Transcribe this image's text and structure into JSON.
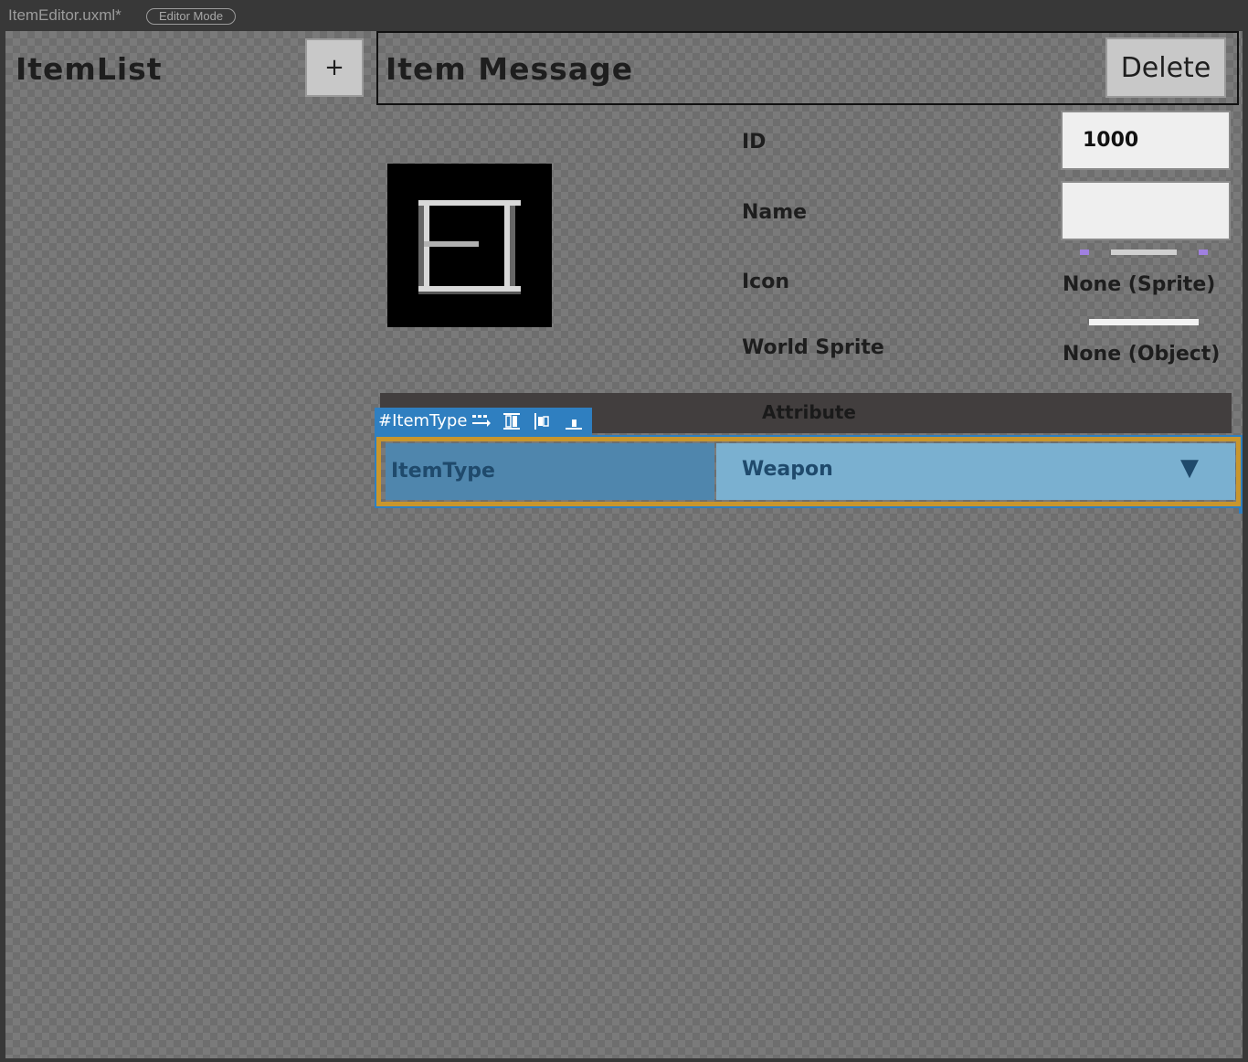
{
  "titlebar": {
    "file": "ItemEditor.uxml*",
    "mode": "Editor Mode"
  },
  "left": {
    "title": "ItemList",
    "add_label": "+"
  },
  "header": {
    "title": "Item Message",
    "delete_label": "Delete"
  },
  "fields": {
    "id_label": "ID",
    "id_value": "1000",
    "name_label": "Name",
    "name_value": "",
    "icon_label": "Icon",
    "icon_value": "None (Sprite)",
    "world_label": "World Sprite",
    "world_value": "None (Object)"
  },
  "attribute": {
    "title": "Attribute"
  },
  "selection": {
    "tag": "#ItemType"
  },
  "itemtype": {
    "label": "ItemType",
    "value": "Weapon",
    "arrow": "▼"
  },
  "colors": {
    "selection_blue": "#2f7fc0",
    "highlight_orange": "#c8962e",
    "dropdown_bg": "#7ab0d0"
  }
}
